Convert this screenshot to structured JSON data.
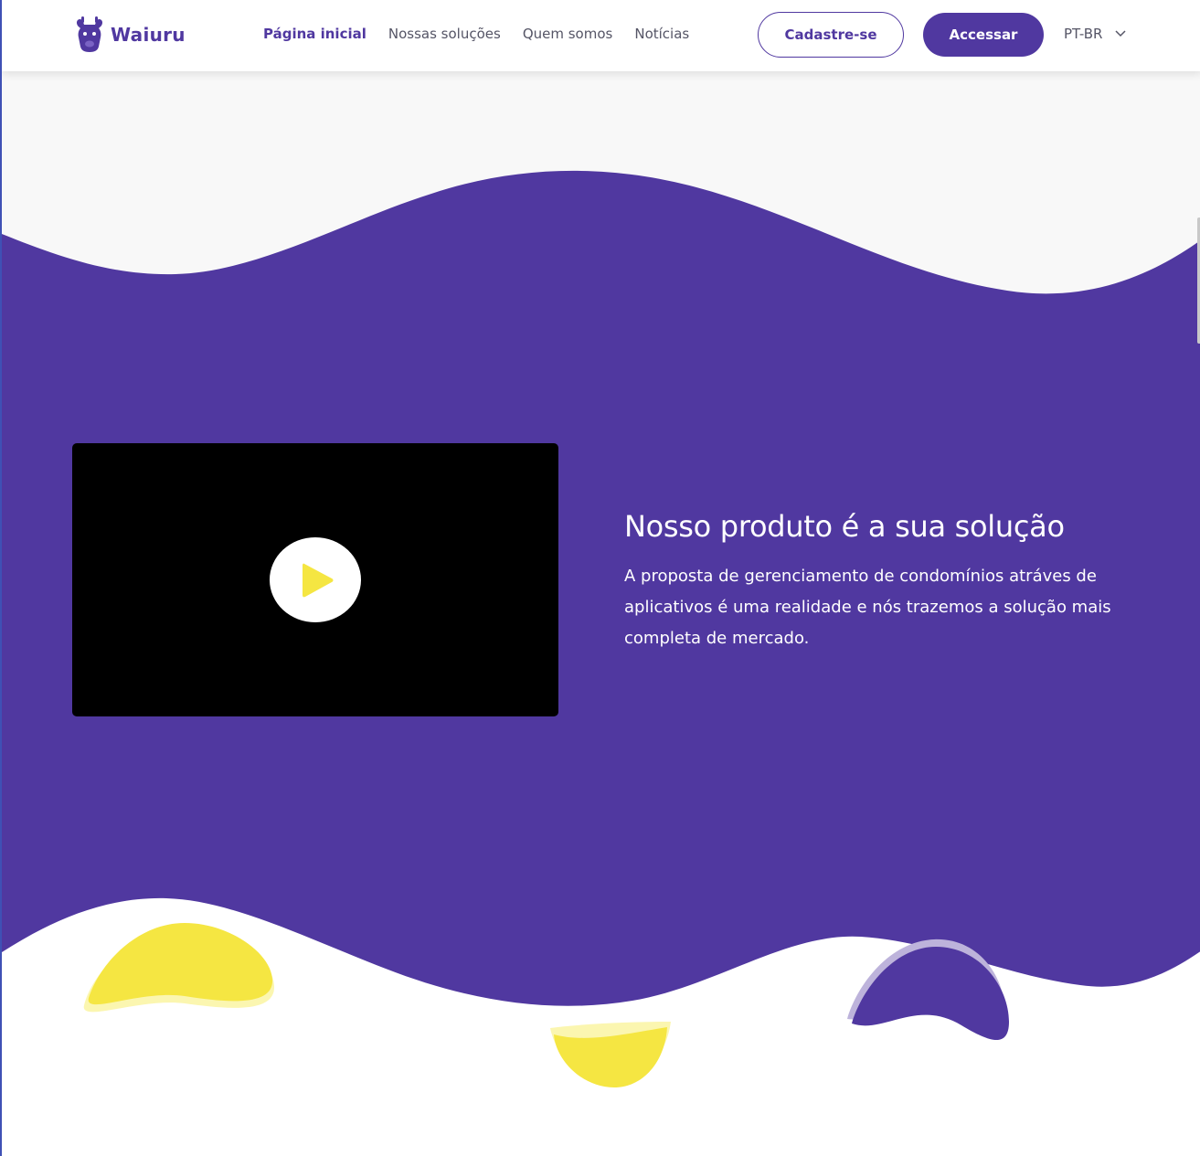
{
  "brand": {
    "name": "Waiuru",
    "logo": "giraffe-logo-icon",
    "primary_color": "#5038a0",
    "accent_color": "#f5e642"
  },
  "nav": {
    "items": [
      {
        "label": "Página inicial",
        "active": true
      },
      {
        "label": "Nossas soluções",
        "active": false
      },
      {
        "label": "Quem somos",
        "active": false
      },
      {
        "label": "Notícias",
        "active": false
      }
    ]
  },
  "header": {
    "signup_label": "Cadastre-se",
    "login_label": "Accessar",
    "language": "PT-BR",
    "language_icon": "chevron-down-icon"
  },
  "hero": {
    "video_icon": "play-icon",
    "title": "Nosso produto é a sua solução",
    "description": "A proposta de gerenciamento de condomínios atráves de aplicativos é uma realidade e nós trazemos a solução mais completa de mercado."
  }
}
